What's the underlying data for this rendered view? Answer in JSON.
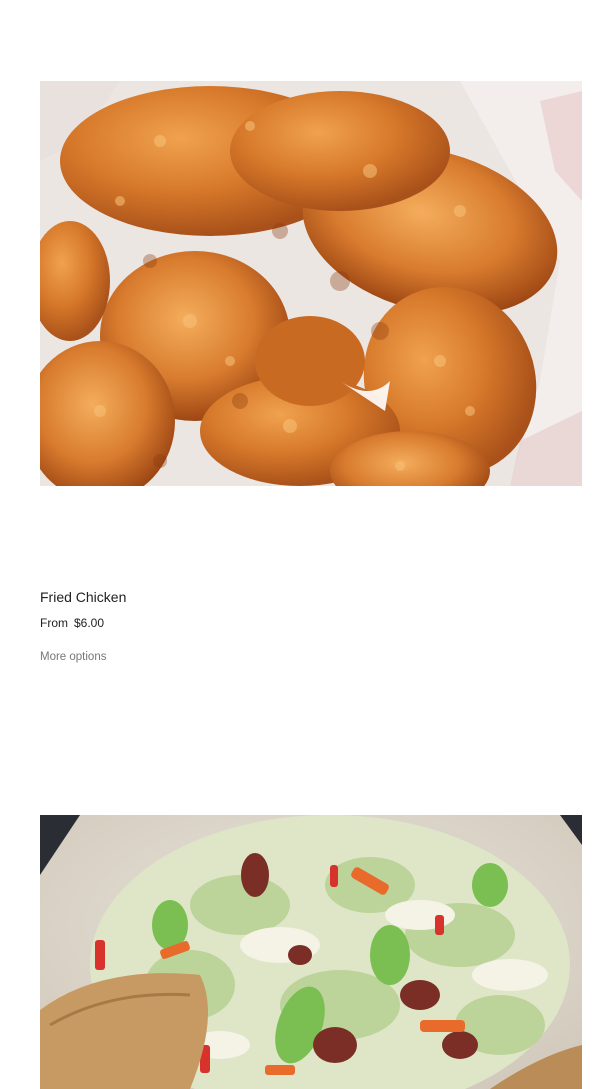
{
  "products": [
    {
      "title": "Fried Chicken",
      "price_prefix": "From",
      "price": "$6.00",
      "more_options": "More options",
      "image_alt": "Fried Chicken"
    },
    {
      "image_alt": "Fried Cabbage"
    }
  ]
}
